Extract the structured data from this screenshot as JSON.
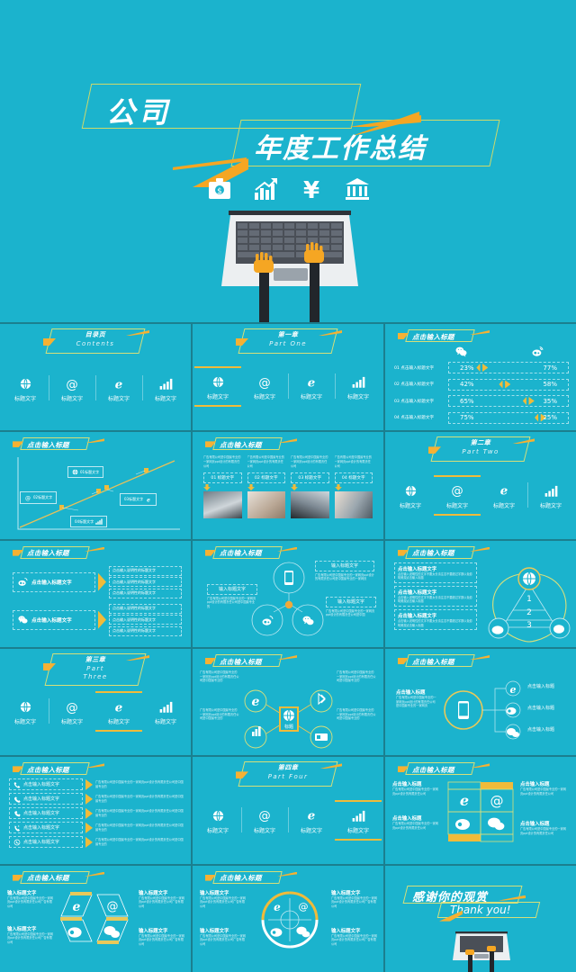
{
  "theme": {
    "bg": "#1bb3cd",
    "gutter": "#1b7f8f",
    "accent": "#f5b133",
    "accent_line": "#d6df7a",
    "text": "#ffffff"
  },
  "cover": {
    "title_line1": "公司",
    "title_line2": "年度工作总结",
    "icons": [
      "briefcase-money-icon",
      "bar-chart-arrow-icon",
      "yen-icon",
      "bank-icon"
    ]
  },
  "common": {
    "title_click": "点击输入标题",
    "label_text": "标题文字",
    "input_title_text": "输入标题文字",
    "click_input_title": "点击输入标题",
    "click_input_title_text": "点击输入标题文字",
    "click_input_desc": "点击输入说明性的标题文字",
    "lorem_short": "广告有限公司是中国最专业的一家网页ppt设计的有限责任公司",
    "lorem_mid": "广告有限公司是中国最专业的一家网页ppt设计的有限责任公司是中国最专业的",
    "lorem_long": "点击输入说明性的文字不要太长请注意不要超过字数以免影响美观点击输入标题文字"
  },
  "slides": [
    {
      "id": "contents",
      "section_title": "目录页",
      "section_sub": "Contents",
      "items": [
        "标题文字",
        "标题文字",
        "标题文字",
        "标题文字"
      ],
      "icons": [
        "globe-icon",
        "at-icon",
        "ie-icon",
        "bars-icon"
      ],
      "active": -1
    },
    {
      "id": "part-one",
      "section_title": "第一章",
      "section_sub": "Part  One",
      "items": [
        "标题文字",
        "标题文字",
        "标题文字",
        "标题文字"
      ],
      "icons": [
        "globe-icon",
        "at-icon",
        "ie-icon",
        "bars-icon"
      ],
      "active": 0
    },
    {
      "id": "compare-bars",
      "title": "点击输入标题",
      "col_icons": [
        "wechat-icon",
        "weibo-icon"
      ],
      "rows": [
        {
          "label": "01 点击输入标题文字",
          "left": "23%",
          "right": "77%",
          "split": 23
        },
        {
          "label": "02 点击输入标题文字",
          "left": "42%",
          "right": "58%",
          "split": 42
        },
        {
          "label": "03 点击输入标题文字",
          "left": "65%",
          "right": "35%",
          "split": 65
        },
        {
          "label": "04 点击输入标题文字",
          "left": "75%",
          "right": "25%",
          "split": 75
        }
      ]
    },
    {
      "id": "trend-line",
      "title": "点击输入标题",
      "nodes": [
        {
          "label": "01标题文字",
          "icon": "globe-icon"
        },
        {
          "label": "02标题文字",
          "icon": "ie-icon"
        },
        {
          "label": "03标题文字",
          "icon": "at-icon"
        },
        {
          "label": "04标题文字",
          "icon": "bars-icon"
        }
      ]
    },
    {
      "id": "four-photos",
      "title": "点击输入标题",
      "columns": [
        {
          "desc": "广告有限公司是中国最专业的一家网页ppt设计的有限责任公司",
          "label": "01 标题文字"
        },
        {
          "desc": "广告有限公司是中国最专业的一家网页ppt设计的有限责任公司",
          "label": "02 标题文字"
        },
        {
          "desc": "广告有限公司是中国最专业的一家网页ppt设计的有限责任公司",
          "label": "03 标题文字"
        },
        {
          "desc": "广告有限公司是中国最专业的一家网页ppt设计的有限责任公司",
          "label": "04 标题文字"
        }
      ]
    },
    {
      "id": "part-two",
      "section_title": "第二章",
      "section_sub": "Part  Two",
      "items": [
        "标题文字",
        "标题文字",
        "标题文字",
        "标题文字"
      ],
      "icons": [
        "globe-icon",
        "at-icon",
        "ie-icon",
        "bars-icon"
      ],
      "active": 1
    },
    {
      "id": "two-arrow-lists",
      "title": "点击输入标题",
      "blocks": [
        {
          "icon": "weibo-icon",
          "label": "点击输入标题文字",
          "bullets": [
            "点击输入说明性的标题文字",
            "点击输入说明性的标题文字",
            "点击输入说明性的标题文字"
          ]
        },
        {
          "icon": "wechat-icon",
          "label": "点击输入标题文字",
          "bullets": [
            "点击输入说明性的标题文字",
            "点击输入说明性的标题文字",
            "点击输入说明性的标题文字"
          ]
        }
      ]
    },
    {
      "id": "three-circles",
      "title": "点击输入标题",
      "nodes": [
        {
          "icon": "phone-icon",
          "label": "输入标题文字",
          "desc": "广告有限公司是中国最专业的一家网页ppt设计的有限责任公司是中国最专业的一家网页"
        },
        {
          "icon": "weibo-icon",
          "label": "输入标题文字",
          "desc": "广告有限公司是中国最专业的一家网页ppt设计的有限责任公司是中国最专业的"
        },
        {
          "icon": "wechat-icon",
          "label": "输入标题文字",
          "desc": "广告有限公司是中国最专业的一家网页ppt设计的有限责任公司是中国"
        }
      ]
    },
    {
      "id": "triangle-123",
      "title": "点击输入标题",
      "numbers": [
        "1",
        "2",
        "3"
      ],
      "items": [
        {
          "num": "1",
          "label": "点击输入标题文字",
          "desc": "点击输入说明性的文字不要太长请注意不要超过字数以免影响美观点击输入标题"
        },
        {
          "num": "2",
          "label": "点击输入标题文字",
          "desc": "点击输入说明性的文字不要太长请注意不要超过字数以免影响美观点击输入标题"
        },
        {
          "num": "3",
          "label": "点击输入标题文字",
          "desc": "点击输入说明性的文字不要太长请注意不要超过字数以免影响美观点击输入标题"
        }
      ],
      "icons": [
        "globe-icon",
        "weibo-icon",
        "wechat-icon"
      ]
    },
    {
      "id": "part-three",
      "section_title": "第三章",
      "section_sub_1": "Part",
      "section_sub_2": "Three",
      "items": [
        "标题文字",
        "标题文字",
        "标题文字",
        "标题文字"
      ],
      "icons": [
        "globe-icon",
        "at-icon",
        "ie-icon",
        "bars-icon"
      ],
      "active": 2
    },
    {
      "id": "hub-four",
      "title": "点击输入标题",
      "center_label": "标题",
      "center_icon": "globe-icon",
      "spokes": [
        {
          "icon": "ie-icon",
          "desc": "广告有限公司是中国最专业的一家网页ppt设计的有限责任公司是中国最专业的"
        },
        {
          "icon": "bluetooth-icon",
          "desc": "广告有限公司是中国最专业的一家网页ppt设计的有限责任公司是中国最专业的"
        },
        {
          "icon": "bars-icon",
          "desc": "广告有限公司是中国最专业的一家网页ppt设计的有限责任公司是中国最专业的"
        },
        {
          "icon": "card-icon",
          "desc": "广告有限公司是中国最专业的一家网页ppt设计的有限责任公司是中国最专业的"
        }
      ]
    },
    {
      "id": "phone-three",
      "title": "点击输入标题",
      "left": {
        "label": "点击输入标题",
        "desc": "广告有限公司是中国最专业的一家网页ppt设计的有限责任公司是中国最专业的一家网页"
      },
      "center_icon": "phone-icon",
      "rows": [
        {
          "icon": "ie-icon",
          "label": "点击输入标题"
        },
        {
          "icon": "weibo-icon",
          "label": "点击输入标题"
        },
        {
          "icon": "wechat-icon",
          "label": "点击输入标题"
        }
      ]
    },
    {
      "id": "phone-list",
      "title": "点击输入标题",
      "rows": [
        {
          "icon": "phone-icon",
          "label": "点击输入标题文字",
          "desc": "广告有限公司是中国最专业的一家网页ppt设计的有限责任公司是中国最专业的"
        },
        {
          "icon": "phone-icon",
          "label": "点击输入标题文字",
          "desc": "广告有限公司是中国最专业的一家网页ppt设计的有限责任公司是中国最专业的"
        },
        {
          "icon": "phone-icon",
          "label": "点击输入标题文字",
          "desc": "广告有限公司是中国最专业的一家网页ppt设计的有限责任公司是中国最专业的"
        },
        {
          "icon": "phone-icon",
          "label": "点击输入标题文字",
          "desc": "广告有限公司是中国最专业的一家网页ppt设计的有限责任公司是中国最专业的"
        },
        {
          "icon": "phone-icon",
          "label": "点击输入标题文字",
          "desc": "广告有限公司是中国最专业的一家网页ppt设计的有限责任公司是中国最专业的"
        }
      ]
    },
    {
      "id": "part-four",
      "section_title": "第四章",
      "section_sub": "Part  Four",
      "items": [
        "标题文字",
        "标题文字",
        "标题文字",
        "标题文字"
      ],
      "icons": [
        "globe-icon",
        "at-icon",
        "ie-icon",
        "bars-icon"
      ],
      "active": 3
    },
    {
      "id": "quad-grid",
      "title": "点击输入标题",
      "quads": [
        {
          "icon": "ie-icon",
          "label": "点击输入标题",
          "desc": "广告有限公司是中国最专业的一家网页ppt设计的有限责任公司"
        },
        {
          "icon": "at-icon",
          "label": "点击输入标题",
          "desc": "广告有限公司是中国最专业的一家网页ppt设计的有限责任公司"
        },
        {
          "icon": "weibo-icon",
          "label": "点击输入标题",
          "desc": "广告有限公司是中国最专业的一家网页ppt设计的有限责任公司"
        },
        {
          "icon": "wechat-icon",
          "label": "点击输入标题",
          "desc": "广告有限公司是中国最专业的一家网页ppt设计的有限责任公司"
        }
      ]
    },
    {
      "id": "hex-grid",
      "title": "点击输入标题",
      "quads": [
        {
          "icon": "ie-icon",
          "label": "输入标题文字",
          "desc": "广告有限公司是中国最专业的一家网页ppt设计的有限责任公司广告有限公司"
        },
        {
          "icon": "at-icon",
          "label": "输入标题文字",
          "desc": "广告有限公司是中国最专业的一家网页ppt设计的有限责任公司广告有限公司"
        },
        {
          "icon": "weibo-icon",
          "label": "输入标题文字",
          "desc": "广告有限公司是中国最专业的一家网页ppt设计的有限责任公司广告有限公司"
        },
        {
          "icon": "wechat-icon",
          "label": "输入标题文字",
          "desc": "广告有限公司是中国最专业的一家网页ppt设计的有限责任公司广告有限公司"
        }
      ]
    },
    {
      "id": "donut-four",
      "title": "点击输入标题",
      "quads": [
        {
          "icon": "ie-icon",
          "label": "输入标题文字",
          "desc": "广告有限公司是中国最专业的一家网页ppt设计的有限责任公司广告有限公司"
        },
        {
          "icon": "at-icon",
          "label": "输入标题文字",
          "desc": "广告有限公司是中国最专业的一家网页ppt设计的有限责任公司广告有限公司"
        },
        {
          "icon": "weibo-icon",
          "label": "输入标题文字",
          "desc": "广告有限公司是中国最专业的一家网页ppt设计的有限责任公司广告有限公司"
        },
        {
          "icon": "wechat-icon",
          "label": "输入标题文字",
          "desc": "广告有限公司是中国最专业的一家网页ppt设计的有限责任公司广告有限公司"
        }
      ]
    },
    {
      "id": "thank-you",
      "title_cn": "感谢你的观赏",
      "title_en": "Thank you!"
    }
  ]
}
